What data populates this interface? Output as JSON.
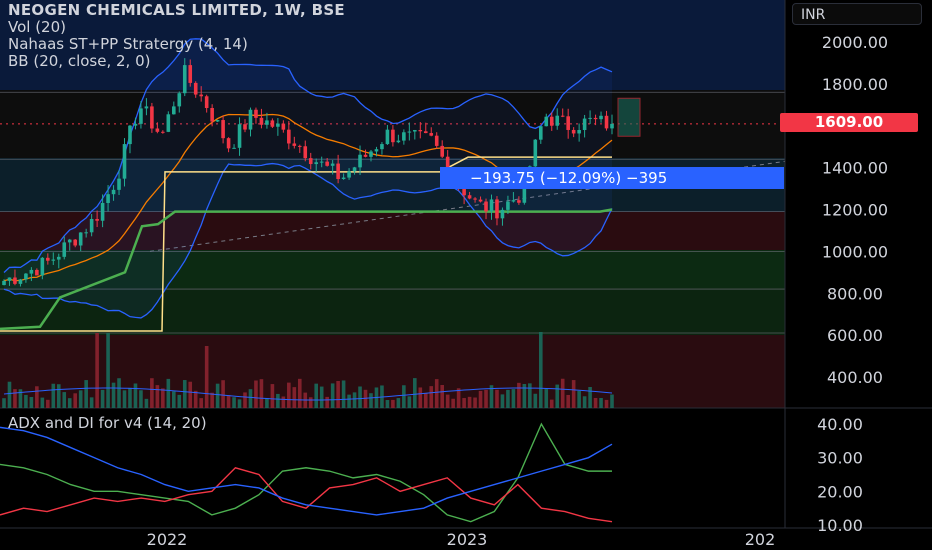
{
  "legend": {
    "title": "NEOGEN CHEMICALS LIMITED, 1W, BSE",
    "vol": "Vol (20)",
    "strategy": "Nahaas ST+PP Stratergy  (4, 14)",
    "bb": "BB (20, close, 2, 0)"
  },
  "sub_legend": "ADX and DI for v4 (14, 20)",
  "currency": "INR",
  "last_price": "1609.00",
  "measure_label": "−193.75 (−12.09%) −395",
  "colors": {
    "up": "#22ab94",
    "down": "#f23645",
    "bb": "#2962ff",
    "green": "#4caf50",
    "yellow": "#ffe08a",
    "orange": "#f57c00",
    "measure": "#2962ff"
  },
  "chart_data": [
    {
      "type": "candlestick",
      "title": "NEOGEN CHEMICALS LIMITED, 1W, BSE",
      "y_ticks": [
        "2000.00",
        "1800.00",
        "1600.00",
        "1400.00",
        "1200.00",
        "1000.00",
        "800.00",
        "600.00",
        "400.00"
      ],
      "x_ticks": [
        "2022",
        "2023",
        "202"
      ],
      "ylim": [
        250,
        2100
      ],
      "close_path": [
        [
          "2021-04",
          860
        ],
        [
          "2021-05",
          900
        ],
        [
          "2021-06",
          950
        ],
        [
          "2021-07",
          1050
        ],
        [
          "2021-08",
          1150
        ],
        [
          "2021-09",
          1350
        ],
        [
          "2021-10",
          1700
        ],
        [
          "2021-11",
          1550
        ],
        [
          "2021-12",
          1850
        ],
        [
          "2022-01",
          1700
        ],
        [
          "2022-02",
          1500
        ],
        [
          "2022-03",
          1650
        ],
        [
          "2022-04",
          1600
        ],
        [
          "2022-05",
          1520
        ],
        [
          "2022-06",
          1420
        ],
        [
          "2022-07",
          1350
        ],
        [
          "2022-08",
          1450
        ],
        [
          "2022-09",
          1560
        ],
        [
          "2022-10",
          1540
        ],
        [
          "2022-11",
          1530
        ],
        [
          "2022-12",
          1350
        ],
        [
          "2023-01",
          1220
        ],
        [
          "2023-02",
          1200
        ],
        [
          "2023-03",
          1280
        ],
        [
          "2023-04",
          1650
        ],
        [
          "2023-05",
          1600
        ],
        [
          "2023-06",
          1620
        ],
        [
          "2023-07",
          1609
        ]
      ],
      "last_price": 1609.0,
      "horizontal_levels": [
        1760,
        1440,
        1190,
        1000,
        820,
        610
      ]
    },
    {
      "type": "line",
      "title": "ADX and DI for v4 (14, 20)",
      "y_ticks": [
        "40.00",
        "30.00",
        "20.00",
        "10.00"
      ],
      "ylim": [
        10,
        42
      ],
      "series": [
        {
          "values": [
            28,
            27,
            25,
            22,
            20,
            20,
            19,
            18,
            17,
            13,
            15,
            19,
            26,
            27,
            26,
            24,
            25,
            23,
            19,
            13,
            11,
            14,
            24,
            40,
            28,
            26,
            26
          ]
        },
        {
          "values": [
            13,
            15,
            14,
            16,
            18,
            17,
            18,
            17,
            19,
            20,
            27,
            25,
            17,
            15,
            21,
            22,
            24,
            20,
            22,
            24,
            18,
            16,
            22,
            15,
            14,
            12,
            11
          ]
        },
        {
          "values": [
            39,
            38,
            36,
            33,
            30,
            27,
            25,
            22,
            20,
            21,
            22,
            21,
            18,
            16,
            15,
            14,
            13,
            14,
            15,
            18,
            20,
            22,
            24,
            26,
            28,
            30,
            34
          ]
        }
      ]
    }
  ]
}
